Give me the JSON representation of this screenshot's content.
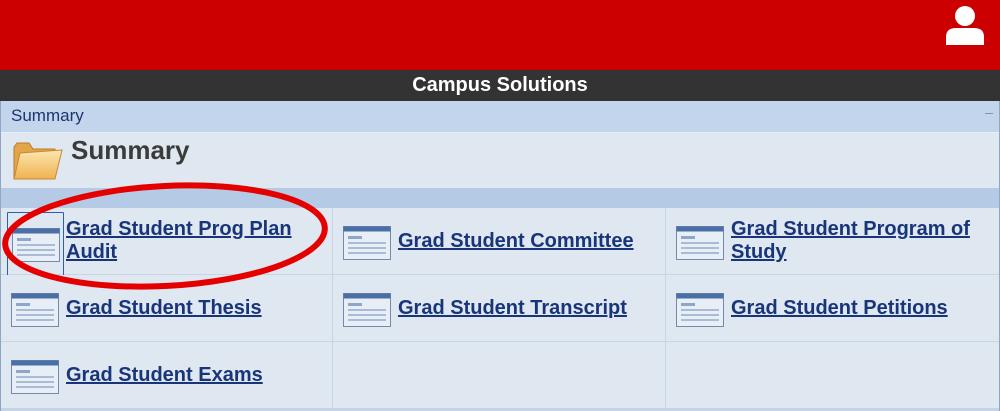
{
  "header": {
    "icons": {
      "user": "user-silhouette-icon"
    },
    "colors": {
      "brand_red": "#cc0000",
      "titlebar_bg": "#333333",
      "link": "#19357a"
    }
  },
  "titlebar": {
    "title": "Campus Solutions"
  },
  "panel": {
    "header_label": "Summary",
    "summary_title": "Summary",
    "folder_icon": "folder-icon"
  },
  "links": [
    {
      "label": "Grad Student Prog Plan Audit",
      "icon": "page-icon",
      "selected": true
    },
    {
      "label": "Grad Student Committee",
      "icon": "page-icon"
    },
    {
      "label": "Grad Student Program of Study",
      "icon": "page-icon"
    },
    {
      "label": "Grad Student Thesis",
      "icon": "page-icon"
    },
    {
      "label": "Grad Student Transcript",
      "icon": "page-icon"
    },
    {
      "label": "Grad Student Petitions",
      "icon": "page-icon"
    },
    {
      "label": "Grad Student Exams",
      "icon": "page-icon"
    }
  ],
  "annotation": {
    "type": "red-ellipse",
    "color": "#e50000",
    "target": "Grad Student Prog Plan Audit"
  }
}
